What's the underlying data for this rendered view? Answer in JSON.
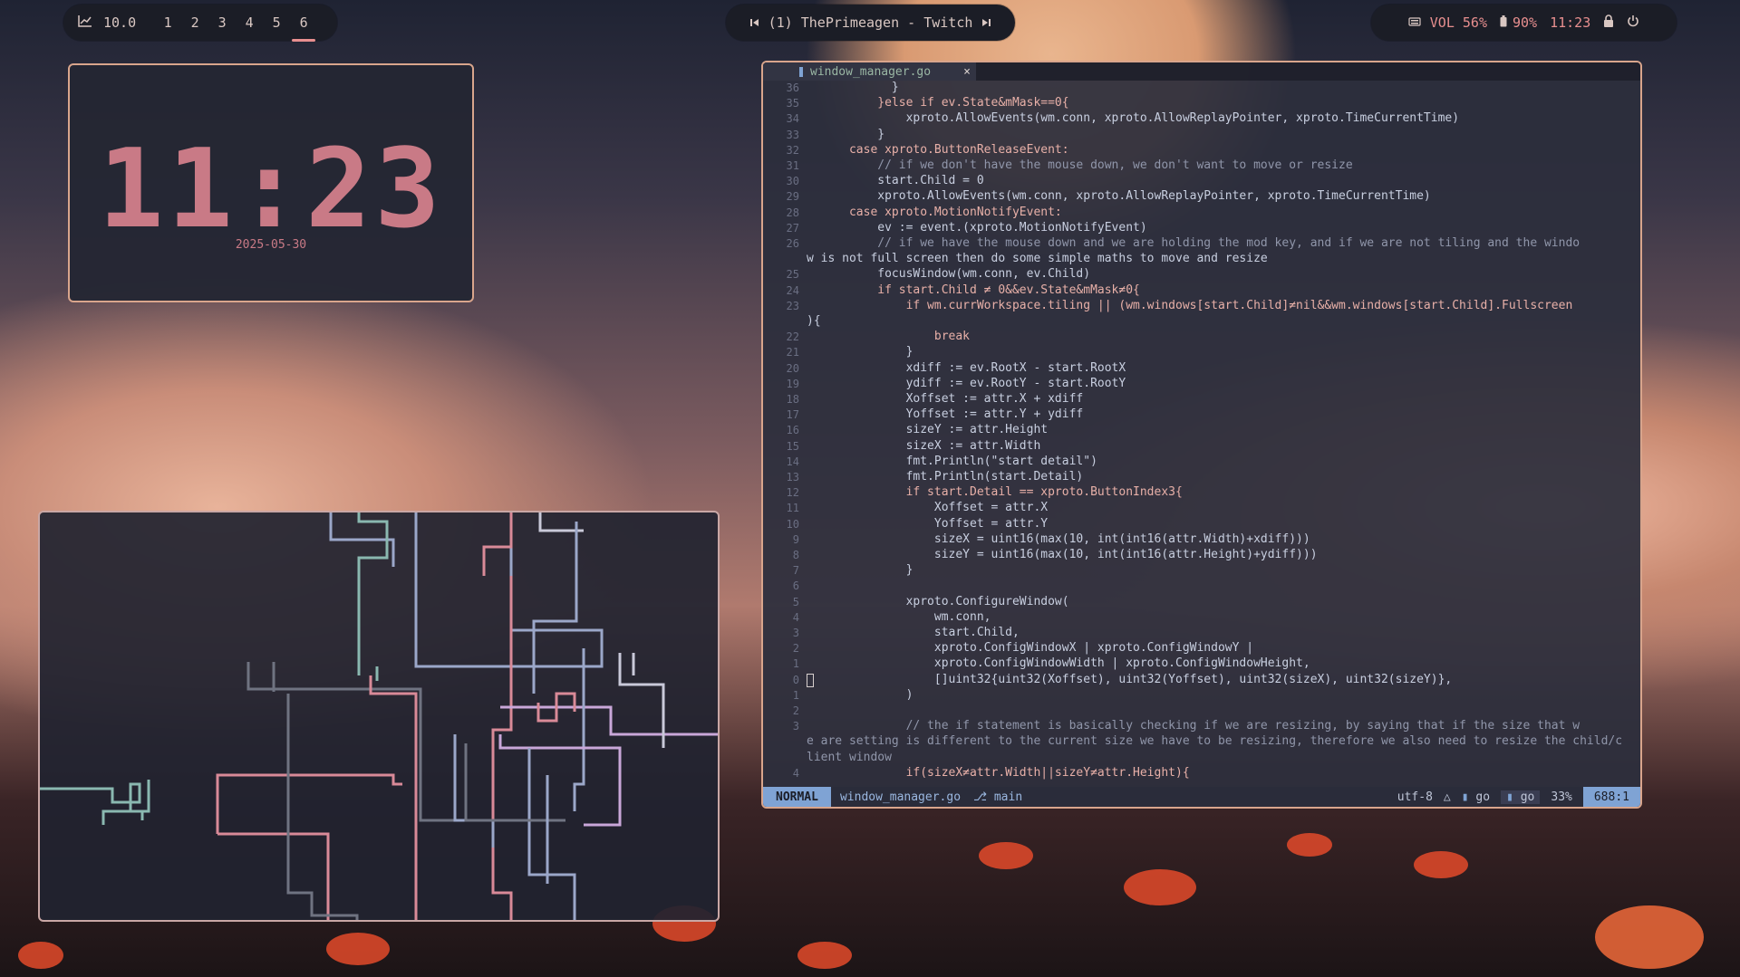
{
  "panel": {
    "left": {
      "graph_icon": "chart-icon",
      "load_value": "10.0",
      "workspaces": [
        "1",
        "2",
        "3",
        "4",
        "5",
        "6"
      ],
      "active_workspace": "6"
    },
    "center": {
      "prev_icon": "skip-back-icon",
      "title": "(1) ThePrimeagen - Twitch",
      "next_icon": "skip-forward-icon"
    },
    "right": {
      "volume_label": "VOL 56%",
      "battery_label": "90%",
      "time": "11:23",
      "lock_icon": "lock-icon",
      "power_icon": "power-icon"
    }
  },
  "clock_widget": {
    "time": "11:23",
    "date": "2025-05-30"
  },
  "editor": {
    "tab_name": "window_manager.go",
    "tab_close": "×",
    "lines": [
      {
        "n": "36",
        "t": "            }"
      },
      {
        "n": "35",
        "t": "          }else if ev.State&mMask==0{"
      },
      {
        "n": "34",
        "t": "              xproto.AllowEvents(wm.conn, xproto.AllowReplayPointer, xproto.TimeCurrentTime)"
      },
      {
        "n": "33",
        "t": "          }"
      },
      {
        "n": "32",
        "t": "      case xproto.ButtonReleaseEvent:"
      },
      {
        "n": "31",
        "t": "          // if we don't have the mouse down, we don't want to move or resize"
      },
      {
        "n": "30",
        "t": "          start.Child = 0"
      },
      {
        "n": "29",
        "t": "          xproto.AllowEvents(wm.conn, xproto.AllowReplayPointer, xproto.TimeCurrentTime)"
      },
      {
        "n": "28",
        "t": "      case xproto.MotionNotifyEvent:"
      },
      {
        "n": "27",
        "t": "          ev := event.(xproto.MotionNotifyEvent)"
      },
      {
        "n": "26",
        "t": "          // if we have the mouse down and we are holding the mod key, and if we are not tiling and the windo"
      },
      {
        "n": "",
        "t": "w is not full screen then do some simple maths to move and resize"
      },
      {
        "n": "25",
        "t": "          focusWindow(wm.conn, ev.Child)"
      },
      {
        "n": "24",
        "t": "          if start.Child ≠ 0&&ev.State&mMask≠0{"
      },
      {
        "n": "23",
        "t": "              if wm.currWorkspace.tiling || (wm.windows[start.Child]≠nil&&wm.windows[start.Child].Fullscreen"
      },
      {
        "n": "",
        "t": "){"
      },
      {
        "n": "22",
        "t": "                  break"
      },
      {
        "n": "21",
        "t": "              }"
      },
      {
        "n": "20",
        "t": "              xdiff := ev.RootX - start.RootX"
      },
      {
        "n": "19",
        "t": "              ydiff := ev.RootY - start.RootY"
      },
      {
        "n": "18",
        "t": "              Xoffset := attr.X + xdiff"
      },
      {
        "n": "17",
        "t": "              Yoffset := attr.Y + ydiff"
      },
      {
        "n": "16",
        "t": "              sizeY := attr.Height"
      },
      {
        "n": "15",
        "t": "              sizeX := attr.Width"
      },
      {
        "n": "14",
        "t": "              fmt.Println(\"start detail\")"
      },
      {
        "n": "13",
        "t": "              fmt.Println(start.Detail)"
      },
      {
        "n": "12",
        "t": "              if start.Detail == xproto.ButtonIndex3{"
      },
      {
        "n": "11",
        "t": "                  Xoffset = attr.X"
      },
      {
        "n": "10",
        "t": "                  Yoffset = attr.Y"
      },
      {
        "n": "9",
        "t": "                  sizeX = uint16(max(10, int(int16(attr.Width)+xdiff)))"
      },
      {
        "n": "8",
        "t": "                  sizeY = uint16(max(10, int(int16(attr.Height)+ydiff)))"
      },
      {
        "n": "7",
        "t": "              }"
      },
      {
        "n": "6",
        "t": ""
      },
      {
        "n": "5",
        "t": "              xproto.ConfigureWindow("
      },
      {
        "n": "4",
        "t": "                  wm.conn,"
      },
      {
        "n": "3",
        "t": "                  start.Child,"
      },
      {
        "n": "2",
        "t": "                  xproto.ConfigWindowX | xproto.ConfigWindowY |"
      },
      {
        "n": "1",
        "t": "                  xproto.ConfigWindowWidth | xproto.ConfigWindowHeight,"
      },
      {
        "n": "0",
        "t": "                  []uint32{uint32(Xoffset), uint32(Yoffset), uint32(sizeX), uint32(sizeY)},"
      },
      {
        "n": "1",
        "t": "              )"
      },
      {
        "n": "2",
        "t": ""
      },
      {
        "n": "3",
        "t": "              // the if statement is basically checking if we are resizing, by saying that if the size that w"
      },
      {
        "n": "",
        "t": "e are setting is different to the current size we have to be resizing, therefore we also need to resize the child/c"
      },
      {
        "n": "",
        "t": "lient window"
      },
      {
        "n": "4",
        "t": "              if(sizeX≠attr.Width||sizeY≠attr.Height){"
      }
    ],
    "status": {
      "mode": "NORMAL",
      "file": "window_manager.go",
      "branch": "main",
      "encoding": "utf-8",
      "filetype": "go",
      "lsp": "go",
      "percent": "33%",
      "position": "688:1"
    }
  },
  "colors": {
    "accent": "#e88f8f",
    "panel_bg": "#1b1d26",
    "editor_border": "#d9a58c",
    "mode_bg": "#7fa3d4"
  }
}
